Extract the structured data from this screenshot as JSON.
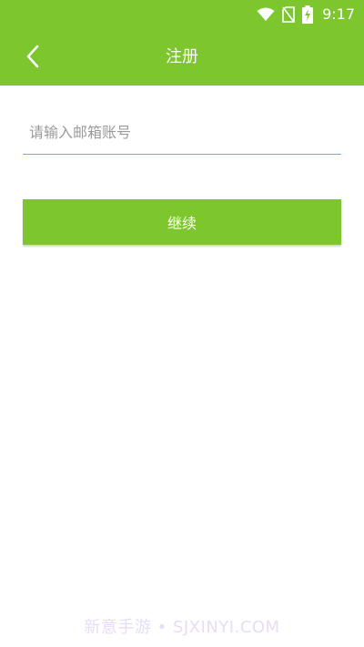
{
  "status_bar": {
    "time": "9:17",
    "icons": [
      "wifi-icon",
      "no-sim-icon",
      "battery-charging-icon"
    ]
  },
  "header": {
    "title": "注册",
    "back_icon": "chevron-left-icon",
    "color": "#7dc62e"
  },
  "form": {
    "email_placeholder": "请输入邮箱账号",
    "email_value": "",
    "continue_label": "继续"
  },
  "watermark": {
    "text": "新意手游 • SJXINYI.COM"
  }
}
